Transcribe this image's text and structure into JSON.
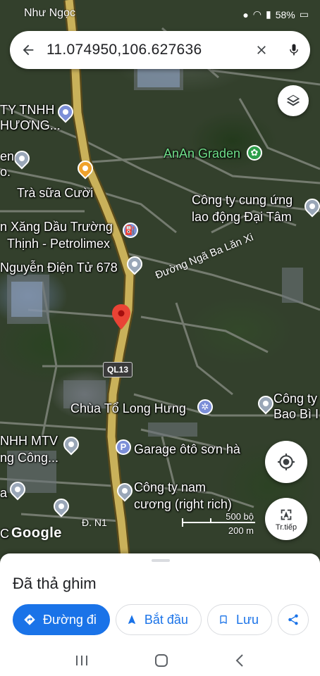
{
  "status_bar": {
    "battery": "58%",
    "overlay_text": "Như Ngọc"
  },
  "search": {
    "query": "11.074950,106.627636"
  },
  "map": {
    "highway_shield": "QL13",
    "street_label": "Đường Ngã Ba Lăn Xi",
    "street_n1": "Đ. N1",
    "google_logo": "Google",
    "scale_ft": "500 bộ",
    "scale_m": "200 m",
    "pois": [
      {
        "label": "TY TNHH"
      },
      {
        "label": "HƯƠNG..."
      },
      {
        "label": "AnAn Graden"
      },
      {
        "label": "Trà sữa Cười"
      },
      {
        "label": "Công ty cung ứng"
      },
      {
        "label": "lao động Đại Tâm"
      },
      {
        "label": "n Xăng Dầu Trường"
      },
      {
        "label": "Thịnh - Petrolimex"
      },
      {
        "label": "Nguyễn Điện Tử 678"
      },
      {
        "label": "Chùa Tổ Long Hưng"
      },
      {
        "label": "Công ty"
      },
      {
        "label": "Bao Bì I"
      },
      {
        "label": "NHH MTV"
      },
      {
        "label": "ng Công..."
      },
      {
        "label": "Garage ôtô sơn hà"
      },
      {
        "label": "Công ty nam"
      },
      {
        "label": "cương (right rich)"
      },
      {
        "label": "en"
      },
      {
        "label": "o."
      },
      {
        "label": "a"
      },
      {
        "label": "C"
      }
    ]
  },
  "fabs": {
    "navigate_label": "Tr.tiếp"
  },
  "sheet": {
    "title": "Đã thả ghim",
    "actions": {
      "directions": "Đường đi",
      "start": "Bắt đầu",
      "save": "Lưu"
    }
  },
  "colors": {
    "accent": "#1a73e8",
    "pin_red": "#ea4335",
    "road_yellow": "#c9b15a"
  }
}
